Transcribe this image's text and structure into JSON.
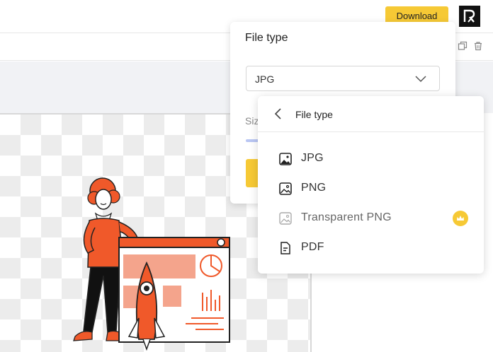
{
  "topbar": {
    "download_label": "Download",
    "logo_icon": "app-logo-icon"
  },
  "toolbar": {
    "icons": [
      "duplicate-icon",
      "trash-icon"
    ]
  },
  "file_type_panel": {
    "title": "File type",
    "selected": "JPG",
    "size_label": "Siz"
  },
  "dropdown": {
    "title": "File type",
    "items": [
      {
        "label": "JPG",
        "icon": "image-filled-icon"
      },
      {
        "label": "PNG",
        "icon": "image-icon"
      },
      {
        "label": "Transparent PNG",
        "icon": "image-light-icon",
        "premium": true
      },
      {
        "label": "PDF",
        "icon": "document-icon"
      }
    ]
  },
  "colors": {
    "accent": "#f6c935",
    "illustration_orange": "#f0592a",
    "slider": "#b9c6f3"
  }
}
